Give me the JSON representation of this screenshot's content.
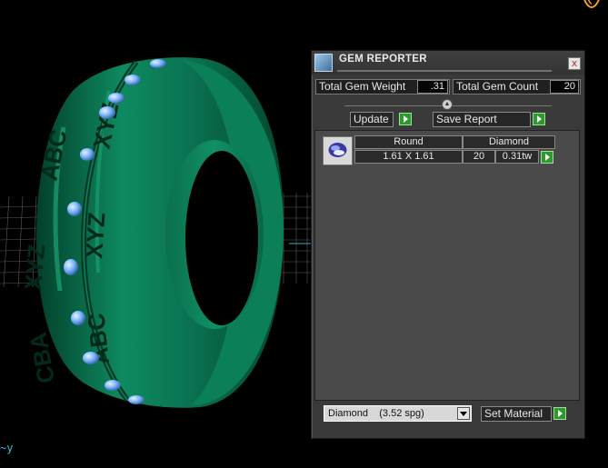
{
  "viewport": {
    "axis_label": "~y",
    "ring_engraving": "XYZ ABC",
    "ring_color": "#0a7a55",
    "gem_color": "#7fb6ff"
  },
  "panel": {
    "title": "GEM REPORTER",
    "close_label": "x",
    "total_weight_label": "Total Gem Weight",
    "total_weight_value": ".31",
    "total_count_label": "Total Gem Count",
    "total_count_value": "20",
    "update_label": "Update",
    "save_report_label": "Save Report",
    "table": {
      "shape_header": "Round",
      "material_header": "Diamond",
      "size": "1.61 X 1.61",
      "count": "20",
      "weight": "0.31tw"
    },
    "material_select_value": "Diamond    (3.52 spg)",
    "set_material_label": "Set Material"
  }
}
